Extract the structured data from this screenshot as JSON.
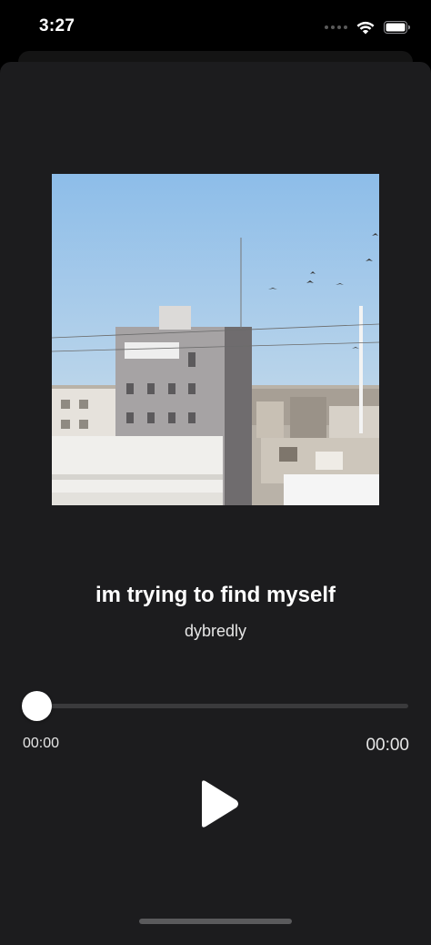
{
  "status_bar": {
    "time": "3:27",
    "icons": [
      "signal-dots-icon",
      "wifi-icon",
      "battery-icon"
    ]
  },
  "player": {
    "artwork_icon": "album-artwork-photo",
    "title": "im trying to find myself",
    "artist": "dybredly",
    "progress": {
      "fraction": 0,
      "elapsed": "00:00",
      "total": "00:00"
    },
    "play_icon": "play-icon"
  },
  "colors": {
    "background": "#000000",
    "sheet": "#1c1c1e",
    "track": "#3a3a3c",
    "thumb": "#ffffff",
    "text": "#ffffff"
  }
}
